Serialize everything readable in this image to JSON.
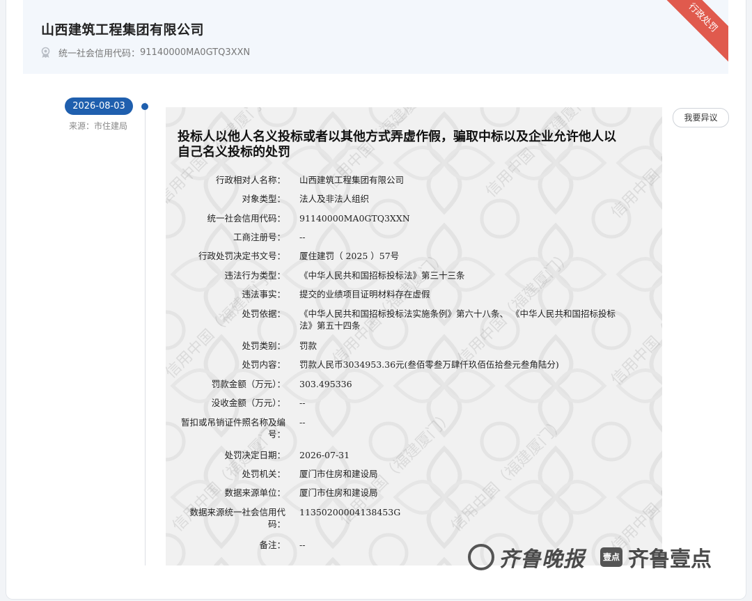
{
  "header": {
    "company_name": "山西建筑工程集团有限公司",
    "credit_code_label": "统一社会信用代码：",
    "credit_code_value": "91140000MA0GTQ3XXN",
    "ribbon": "行政处罚",
    "icon": "badge-icon"
  },
  "timeline": {
    "date": "2026-08-03",
    "source": "来源：市住建局"
  },
  "objection_button": "我要异议",
  "document": {
    "title": "投标人以他人名义投标或者以其他方式弄虚作假，骗取中标以及企业允许他人以自己名义投标的处罚",
    "fields": [
      {
        "label": "行政相对人名称：",
        "value": "山西建筑工程集团有限公司"
      },
      {
        "label": "对象类型：",
        "value": "法人及非法人组织"
      },
      {
        "label": "统一社会信用代码：",
        "value": "91140000MA0GTQ3XXN"
      },
      {
        "label": "工商注册号：",
        "value": "--"
      },
      {
        "label": "行政处罚决定书文号：",
        "value": "厦住建罚（ 2025 ）57号"
      },
      {
        "label": "违法行为类型：",
        "value": "《中华人民共和国招标投标法》第三十三条"
      },
      {
        "label": "违法事实：",
        "value": "提交的业绩项目证明材料存在虚假"
      },
      {
        "label": "处罚依据：",
        "value": "《中华人民共和国招标投标法实施条例》第六十八条、 《中华人民共和国招标投标法》第五十四条"
      },
      {
        "label": "处罚类别：",
        "value": "罚款"
      },
      {
        "label": "处罚内容：",
        "value": "罚款人民币3034953.36元(叁佰零叁万肆仟玖佰伍拾叁元叁角陆分)"
      },
      {
        "label": "罚款金额（万元）：",
        "value": "303.495336"
      },
      {
        "label": "没收金额（万元）：",
        "value": "--"
      },
      {
        "label": "暂扣或吊销证件照名称及编号：",
        "value": "--"
      },
      {
        "label": "处罚决定日期：",
        "value": "2026-07-31"
      },
      {
        "label": "处罚机关：",
        "value": "厦门市住房和建设局"
      },
      {
        "label": "数据来源单位：",
        "value": "厦门市住房和建设局"
      },
      {
        "label": "数据来源统一社会信用代码：",
        "value": "11350200004138453G"
      },
      {
        "label": "备注：",
        "value": "--"
      }
    ],
    "watermark": "信用中国（福建厦门）"
  },
  "logos": {
    "logo1_text": "齐鲁晚报",
    "logo2_box": "壹点",
    "logo2_text": "齐鲁壹点"
  }
}
